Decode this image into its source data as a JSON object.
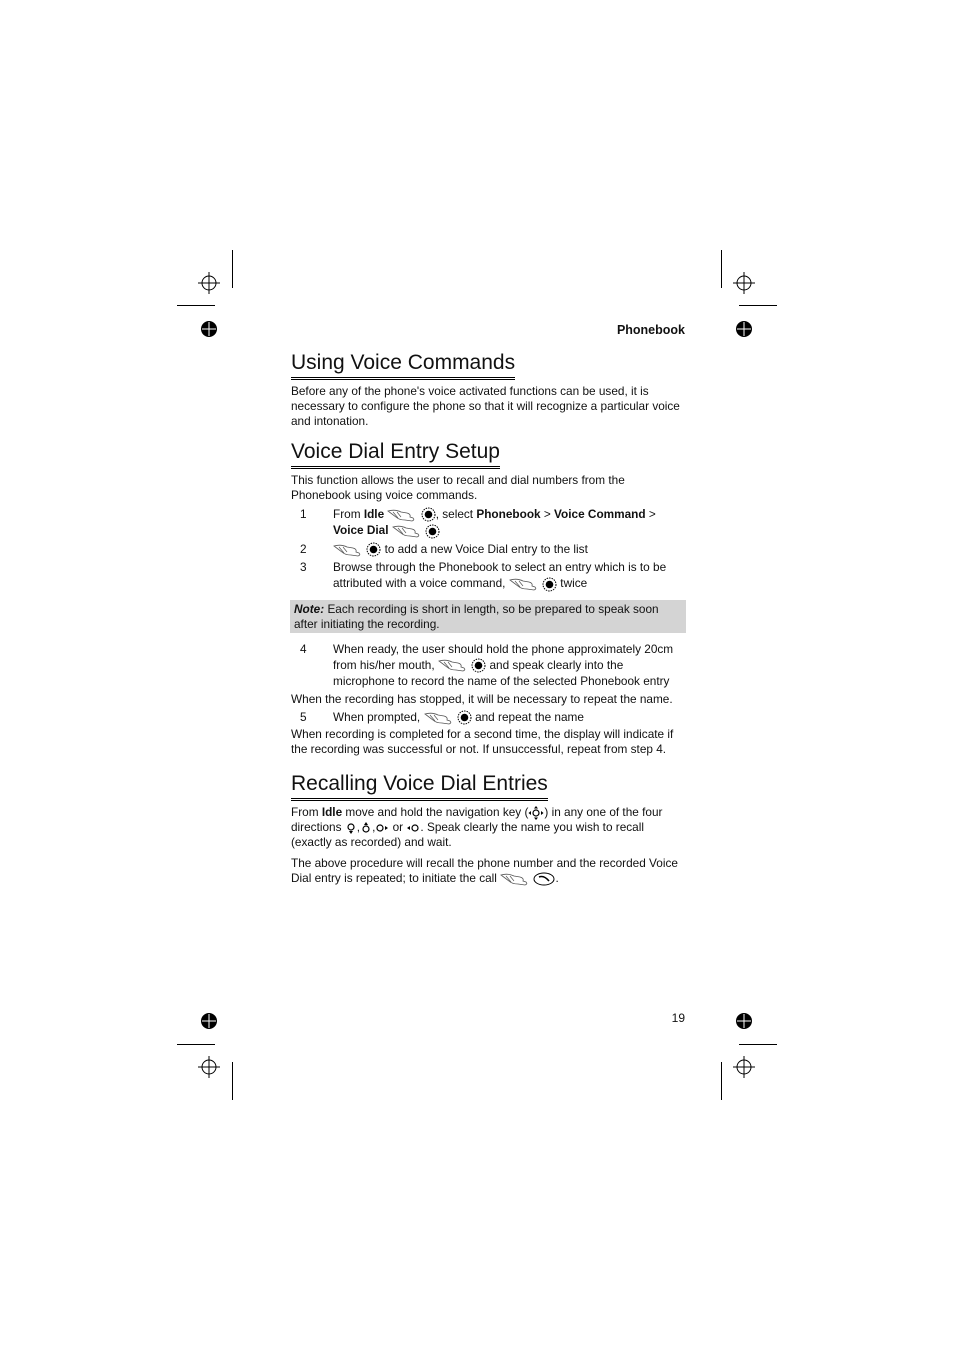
{
  "header": {
    "section": "Phonebook"
  },
  "sections": [
    {
      "title": "Using Voice Commands",
      "paragraphs": [
        "Before any of the phone's voice activated functions can be used, it is necessary to configure the phone so that it will recognize a particular voice and intonation."
      ]
    },
    {
      "title": "Voice Dial Entry Setup",
      "intro": "This function allows the user to recall and dial numbers from the Phonebook using voice commands.",
      "steps": [
        {
          "num": "1",
          "parts": {
            "a": "From ",
            "b1": "Idle",
            "c": ", select ",
            "b2": "Phonebook",
            "d": " > ",
            "b3": "Voice Command",
            "e": " > ",
            "b4": "Voice Dial"
          }
        },
        {
          "num": "2",
          "text": "to add a new Voice Dial entry to the list"
        },
        {
          "num": "3",
          "text": "Browse through the Phonebook to select an entry which is to be attributed with a voice command,",
          "suffix": "twice"
        }
      ],
      "note": {
        "label": "Note:",
        "text": "Each recording is short in length, so be prepared to speak soon after initiating the recording."
      },
      "step4": {
        "num": "4",
        "text1": "When ready, the user should hold the phone approximately 20cm from his/her mouth,",
        "text2": "and speak clearly into the microphone to record the name of the selected Phonebook entry"
      },
      "para_after4": "When the recording has stopped, it will be necessary to repeat the name.",
      "step5": {
        "num": "5",
        "text1": "When prompted,",
        "text2": "and repeat the name"
      },
      "para_final": "When recording is completed for a second time, the display will indicate if the recording was successful or not. If unsuccessful, repeat from step 4."
    },
    {
      "title": "Recalling Voice Dial Entries",
      "p1": {
        "a": "From ",
        "bold": "Idle",
        "b": " move and hold the navigation key (",
        "c": ") in any one of the four directions ",
        "d": " or ",
        "e": ". Speak clearly the name you wish to recall (exactly as recorded) and wait."
      },
      "p2": {
        "text": "The above procedure will recall the phone number and the recorded Voice Dial entry is repeated; to initiate the call",
        "end": "."
      }
    }
  ],
  "icons": {
    "press": "press-hand-icon",
    "select": "select-key-icon",
    "nav": "navigation-key-icon",
    "call": "call-key-icon"
  },
  "footer": {
    "page_number": "19"
  }
}
